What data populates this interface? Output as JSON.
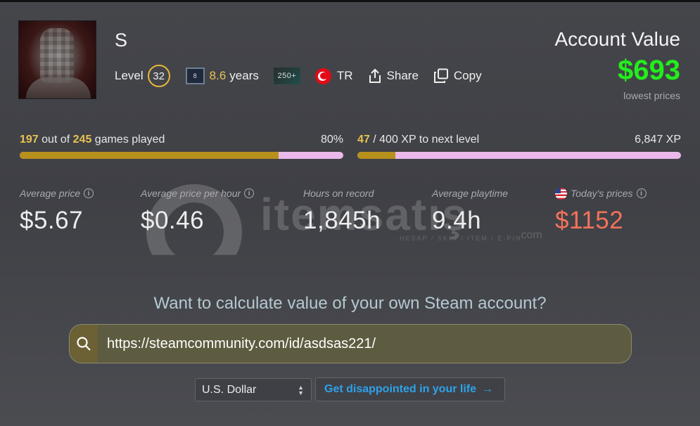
{
  "profile": {
    "username": "S",
    "level_label": "Level",
    "level": "32",
    "years_badge_text": "8",
    "years_value": "8.6",
    "years_unit": "years",
    "games_badge": "250+",
    "country": "TR",
    "share_label": "Share",
    "copy_label": "Copy"
  },
  "account": {
    "title": "Account Value",
    "value": "$693",
    "subtitle": "lowest prices"
  },
  "progress": {
    "games_played": "197",
    "games_out_of_text": "out of",
    "games_total": "245",
    "games_suffix": "games played",
    "games_percent_label": "80%",
    "games_fraction": 0.8,
    "xp_current": "47",
    "xp_rest": "/ 400 XP to next level",
    "xp_total": "6,847 XP",
    "xp_fraction": 0.1175
  },
  "stats": [
    {
      "label": "Average price",
      "value": "$5.67"
    },
    {
      "label": "Average price per hour",
      "value": "$0.46"
    },
    {
      "label": "Hours on record",
      "value": "1,845h"
    },
    {
      "label": "Average playtime",
      "value": "9.4h"
    },
    {
      "label": "Today's prices",
      "value": "$1152"
    }
  ],
  "watermark": {
    "text": "itemsatış",
    "tagline": "HESAP / SKIN / ITEM / E-PIN",
    "tld": ".com"
  },
  "cta": {
    "prompt": "Want to calculate value of your own Steam account?",
    "search_value": "https://steamcommunity.com/id/asdsas221/",
    "currency": "U.S. Dollar",
    "button": "Get disappointed in your life"
  },
  "colors": {
    "account_value": "#23ee1c",
    "highlight": "#e7c352",
    "todays_price": "#f2735a",
    "link": "#2ea2e8"
  }
}
